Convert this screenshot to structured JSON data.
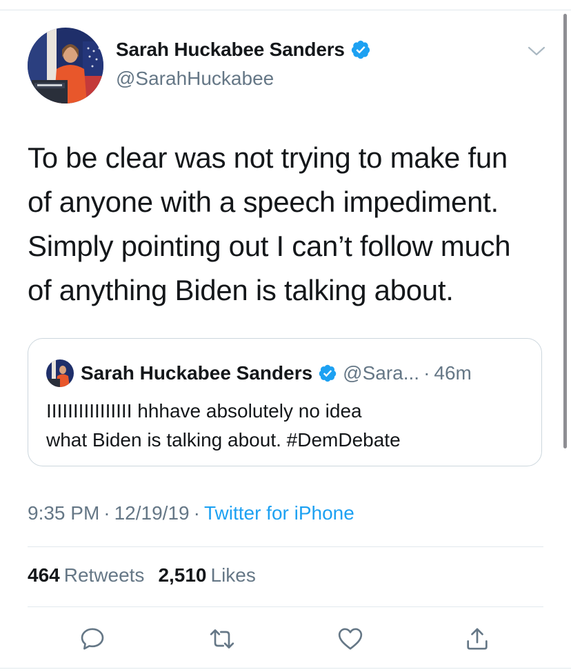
{
  "author": {
    "name": "Sarah Huckabee Sanders",
    "handle": "@SarahHuckabee",
    "verified_icon": "verified-badge-icon"
  },
  "tweet": {
    "text": "To be clear was not trying to make fun\nof anyone with a speech impediment.\nSimply pointing out I can’t follow much\nof anything Biden is talking about."
  },
  "quoted_tweet": {
    "name": "Sarah Huckabee Sanders",
    "handle": "@Sara...",
    "separator": "·",
    "time": "46m",
    "text": "IIIIIIIIIIIIIIII hhhave absolutely no idea\nwhat Biden is talking about. #DemDebate"
  },
  "meta": {
    "time": "9:35 PM",
    "separator": "·",
    "date": "12/19/19",
    "source": "Twitter for iPhone"
  },
  "stats": {
    "retweets_count": "464",
    "retweets_label": "Retweets",
    "likes_count": "2,510",
    "likes_label": "Likes"
  },
  "actions": [
    "reply-icon",
    "retweet-icon",
    "like-icon",
    "share-icon"
  ],
  "colors": {
    "accent": "#1da1f2",
    "secondary_text": "#657786",
    "border": "#e1e8ed"
  }
}
